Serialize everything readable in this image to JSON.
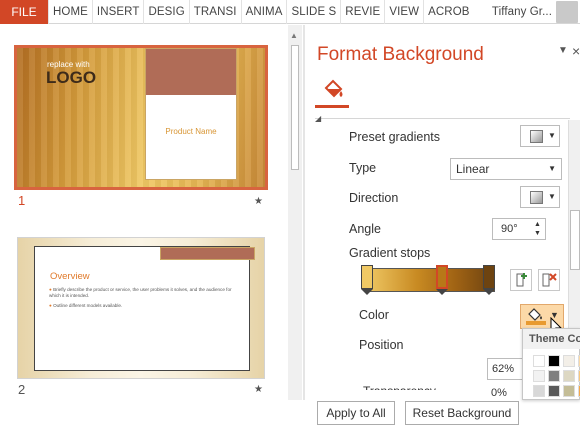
{
  "ribbon": {
    "file": "FILE",
    "tabs": [
      "HOME",
      "INSERT",
      "DESIG",
      "TRANSI",
      "ANIMA",
      "SLIDE S",
      "REVIE",
      "VIEW",
      "ACROB"
    ],
    "user": "Tiffany Gr..."
  },
  "slides": {
    "slide1": {
      "number": "1",
      "tagline": "replace with",
      "logo": "LOGO",
      "product": "Product Name"
    },
    "slide2": {
      "number": "2",
      "heading": "Overview",
      "bullet1": "Briefly describe the product or service, the user problems it solves, and the audience for which it is intended.",
      "bullet2": "Outline different models available."
    }
  },
  "pane": {
    "title": "Format Background",
    "preset_label": "Preset gradients",
    "type_label": "Type",
    "type_value": "Linear",
    "direction_label": "Direction",
    "angle_label": "Angle",
    "angle_value": "90°",
    "stops_label": "Gradient stops",
    "color_label": "Color",
    "position_label": "Position",
    "position_value": "62%",
    "transparency_label": "Transparency",
    "transparency_value": "0%",
    "apply_all": "Apply to All",
    "reset": "Reset Background"
  },
  "popup": {
    "header": "Theme Colors"
  },
  "colors": {
    "accent": "#d24726",
    "stop_colors": [
      "#f0c965",
      "#b87818",
      "#6d4310"
    ]
  },
  "icons": [
    "paint-bucket-icon",
    "add-stop-icon",
    "remove-stop-icon",
    "star-icon",
    "close-icon"
  ]
}
